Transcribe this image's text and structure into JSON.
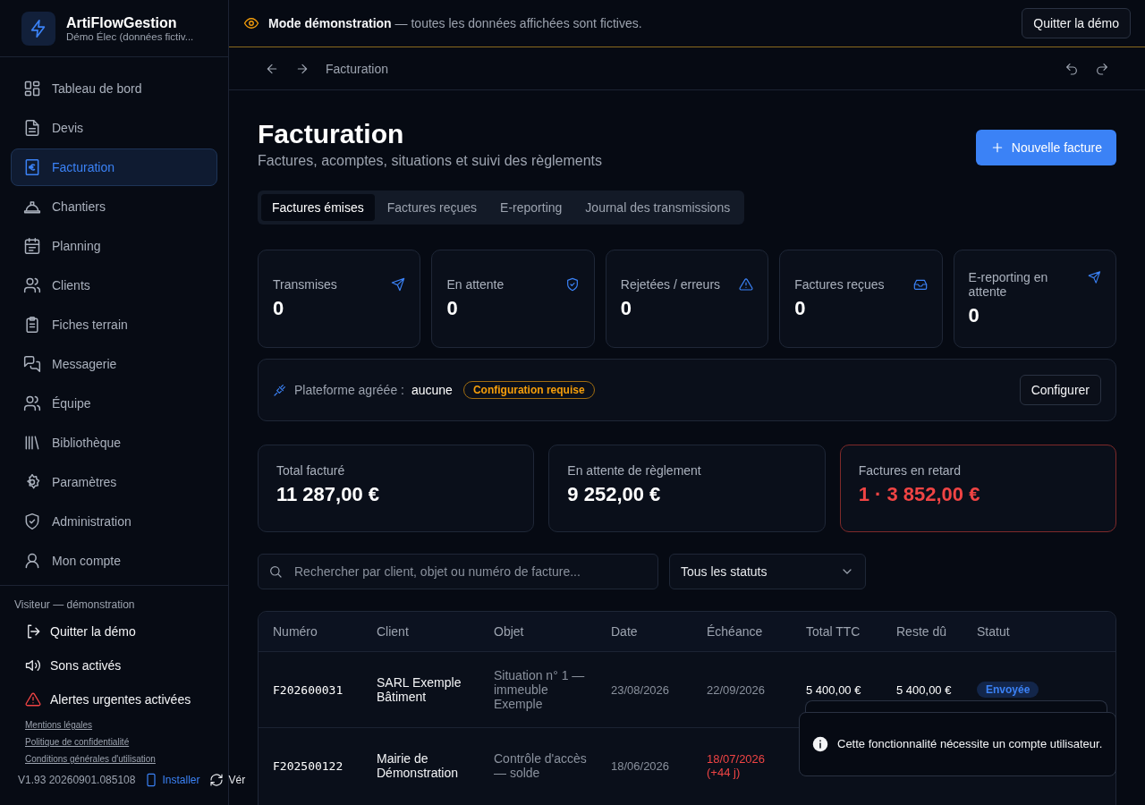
{
  "sidebar": {
    "brand": {
      "title": "ArtiFlowGestion",
      "subtitle": "Démo Élec (données fictiv..."
    },
    "nav": [
      {
        "label": "Tableau de bord",
        "selected": false
      },
      {
        "label": "Devis",
        "selected": false
      },
      {
        "label": "Facturation",
        "selected": true
      },
      {
        "label": "Chantiers",
        "selected": false
      },
      {
        "label": "Planning",
        "selected": false
      },
      {
        "label": "Clients",
        "selected": false
      },
      {
        "label": "Fiches terrain",
        "selected": false
      },
      {
        "label": "Messagerie",
        "selected": false
      },
      {
        "label": "Équipe",
        "selected": false
      },
      {
        "label": "Bibliothèque",
        "selected": false
      },
      {
        "label": "Paramètres",
        "selected": false
      },
      {
        "label": "Administration",
        "selected": false
      },
      {
        "label": "Mon compte",
        "selected": false
      }
    ],
    "user_label": "Visiteur — démonstration",
    "actions": [
      {
        "label": "Quitter la démo",
        "kind": "exit"
      },
      {
        "label": "Sons activés",
        "kind": "sound"
      },
      {
        "label": "Alertes urgentes activées",
        "kind": "alert"
      }
    ],
    "links": [
      "Mentions légales",
      "Politique de confidentialité",
      "Conditions générales d'utilisation"
    ],
    "version": "V1.93 20260901.085108",
    "install": "Installer",
    "update": "Vér"
  },
  "banner": {
    "title": "Mode démonstration",
    "text": "— toutes les données affichées sont fictives.",
    "button": "Quitter la démo"
  },
  "breadcrumb": {
    "title": "Facturation"
  },
  "page": {
    "title": "Facturation",
    "subtitle": "Factures, acomptes, situations et suivi des règlements",
    "new_button": "Nouvelle facture"
  },
  "tabs": [
    {
      "label": "Factures émises",
      "selected": true
    },
    {
      "label": "Factures reçues",
      "selected": false
    },
    {
      "label": "E-reporting",
      "selected": false
    },
    {
      "label": "Journal des transmissions",
      "selected": false
    }
  ],
  "stats": [
    {
      "label": "Transmises",
      "value": "0",
      "kind": "send"
    },
    {
      "label": "En attente",
      "value": "0",
      "kind": "shield"
    },
    {
      "label": "Rejetées / erreurs",
      "value": "0",
      "kind": "warning"
    },
    {
      "label": "Factures reçues",
      "value": "0",
      "kind": "inbox"
    },
    {
      "label": "E-reporting en attente",
      "value": "0",
      "kind": "send"
    }
  ],
  "platform": {
    "label": "Plateforme agréée :",
    "value": "aucune",
    "badge": "Configuration requise",
    "button": "Configurer"
  },
  "totals": [
    {
      "label": "Total facturé",
      "value": "11 287,00 €",
      "alert": false
    },
    {
      "label": "En attente de règlement",
      "value": "9 252,00 €",
      "alert": false
    },
    {
      "label": "Factures en retard",
      "value": "1 · 3 852,00 €",
      "alert": true
    }
  ],
  "filters": {
    "search_placeholder": "Rechercher par client, objet ou numéro de facture...",
    "status_select": "Tous les statuts"
  },
  "table": {
    "columns": [
      "Numéro",
      "Client",
      "Objet",
      "Date",
      "Échéance",
      "Total TTC",
      "Reste dû",
      "Statut"
    ],
    "rows": [
      {
        "number": "F202600031",
        "client": "SARL Exemple Bâtiment",
        "object": "Situation n° 1 — immeuble Exemple",
        "date": "23/08/2026",
        "due": "22/09/2026",
        "overdue": false,
        "total": "5 400,00 €",
        "remaining": "5 400,00 €",
        "status": "Envoyée"
      },
      {
        "number": "F202500122",
        "client": "Mairie de Démonstration",
        "object": "Contrôle d'accès — solde",
        "date": "18/06/2026",
        "due": "18/07/2026",
        "overdue": true,
        "overdue_note": "(+44 j)"
      }
    ]
  },
  "toast": {
    "text": "Cette fonctionnalité nécessite un compte utilisateur."
  }
}
